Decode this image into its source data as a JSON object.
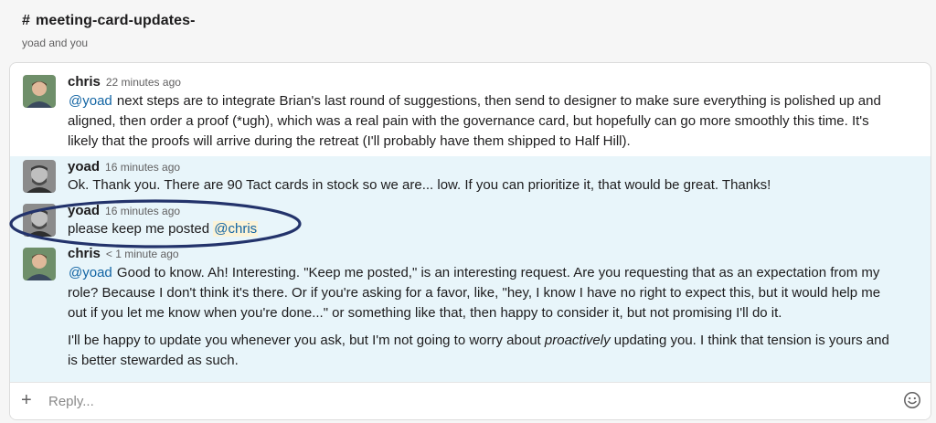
{
  "header": {
    "hash": "#",
    "channel_name": "meeting-card-updates-",
    "members": "yoad and you"
  },
  "messages": [
    {
      "author": "chris",
      "time": "22 minutes ago",
      "mention": "@yoad",
      "text": " next steps are to integrate Brian's last round of suggestions, then send to designer to make sure everything is polished up and aligned, then order a proof (*ugh), which was a real pain with the governance card, but hopefully can go more smoothly this time. It's likely that the proofs will arrive during the retreat (I'll probably have them shipped to Half Hill)."
    },
    {
      "author": "yoad",
      "time": "16 minutes ago",
      "text": "Ok. Thank you. There are 90 Tact cards in stock so we are... low. If you can prioritize it, that would be great. Thanks!"
    },
    {
      "author": "yoad",
      "time": "16 minutes ago",
      "text": "please keep me posted ",
      "mention": "@chris"
    },
    {
      "author": "chris",
      "time": "< 1 minute ago",
      "mention": "@yoad",
      "text": " Good to know. Ah! Interesting. \"Keep me posted,\" is an interesting request. Are you requesting that as an expectation from my role? Because I don't think it's there. Or if you're asking for a favor, like, \"hey, I know I have no right to expect this, but it would help me out if you let me know when you're done...\" or something like that, then happy to consider it, but not promising I'll do it.",
      "para2_before": "I'll be happy to update you whenever you ask, but I'm not going to worry about ",
      "para2_emphasis": "proactively",
      "para2_after": " updating you. I think that tension is yours and is better stewarded as such."
    }
  ],
  "composer": {
    "plus": "+",
    "placeholder": "Reply..."
  },
  "icons": {
    "add": "plus-icon",
    "emoji": "smiley-icon"
  },
  "colors": {
    "mention_link": "#1264a3",
    "mention_highlight": "#fbf3d8",
    "thread_highlight": "#e8f5fa",
    "annotation": "#23336b"
  }
}
